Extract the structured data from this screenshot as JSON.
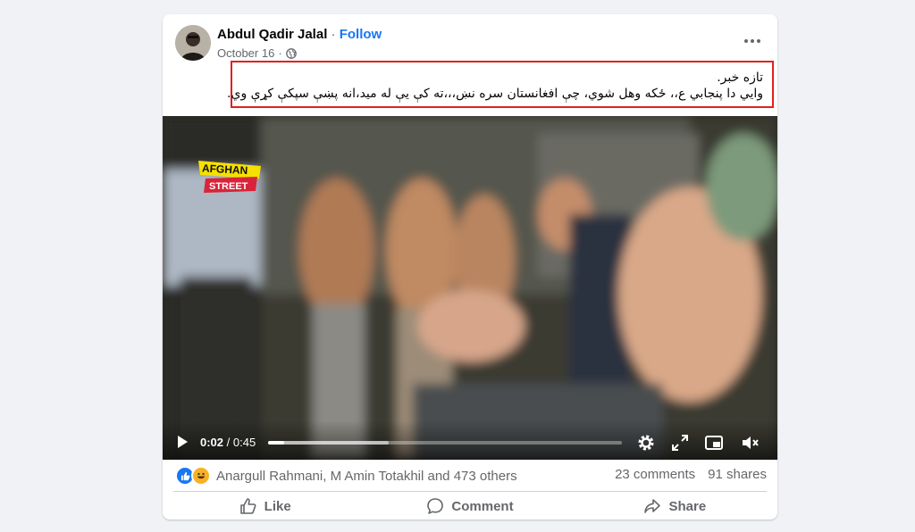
{
  "post": {
    "author": "Abdul Qadir Jalal",
    "separator": "·",
    "follow_label": "Follow",
    "date": "October 16",
    "date_separator": "·",
    "privacy_icon": "globe-icon",
    "more_icon": "more-horizontal-icon",
    "text_line_1": "تازه خبر.",
    "text_line_2": "وایي دا پنجابي ع،، ځکه وهل شوي، چې افغانستان سره نښ،،،ته کې یې له مید،انه پښې سپکې کړې وي."
  },
  "video": {
    "watermark_line_1": "AFGHAN",
    "watermark_line_2": "STREET",
    "current_time": "0:02",
    "time_separator": " / ",
    "duration": "0:45",
    "progress_fraction": 0.045,
    "icons": [
      "play-icon",
      "settings-icon",
      "fullscreen-icon",
      "picture-in-picture-icon",
      "mute-icon"
    ]
  },
  "engagement": {
    "reaction_icons": [
      "like-reaction-icon",
      "haha-reaction-icon"
    ],
    "reactors": "Anargull Rahmani, M Amin Totakhil and 473 others",
    "comments": "23 comments",
    "shares": "91 shares"
  },
  "actions": {
    "like_label": "Like",
    "comment_label": "Comment",
    "share_label": "Share"
  },
  "colors": {
    "accent": "#1877f2",
    "highlight_border": "#e02020",
    "watermark_yellow": "#f5e000",
    "watermark_red": "#d8243a"
  }
}
